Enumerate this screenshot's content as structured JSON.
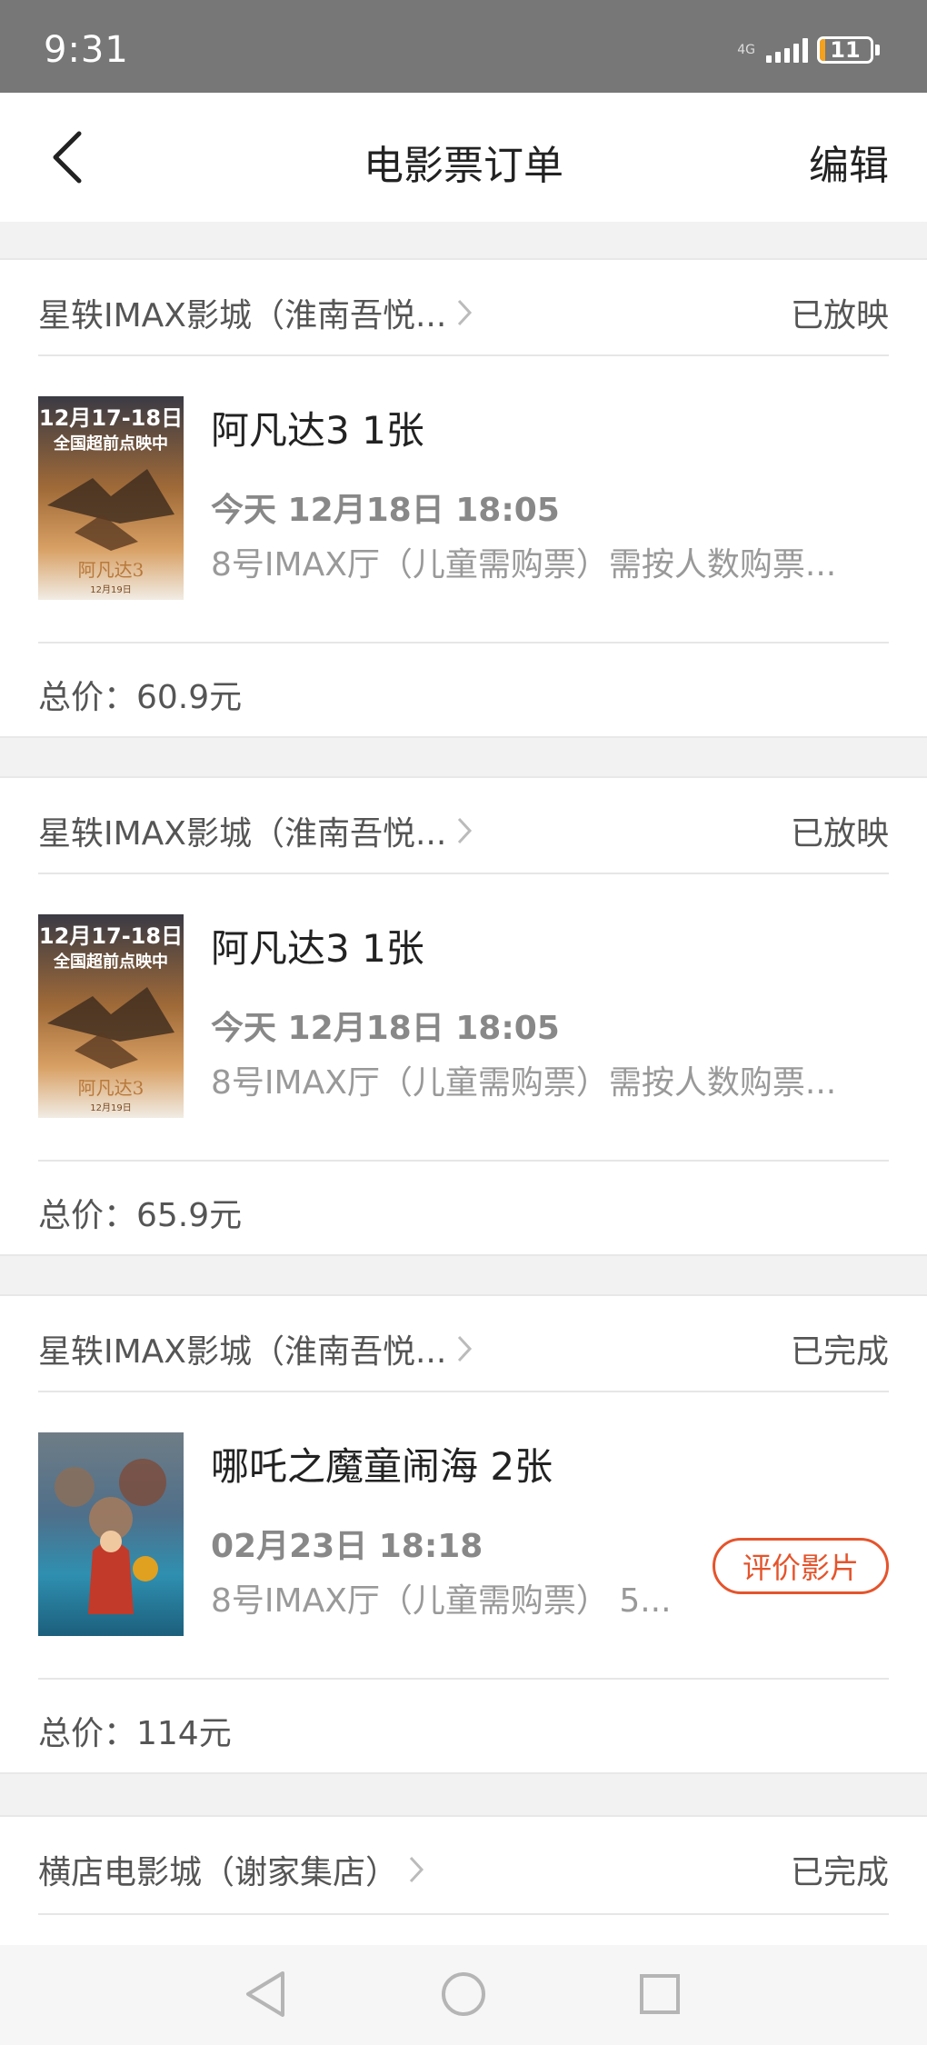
{
  "status_bar": {
    "time": "9:31",
    "network_small": "4G",
    "battery": "11",
    "battery_level": 0.11
  },
  "nav": {
    "title": "电影票订单",
    "edit_label": "编辑"
  },
  "orders": [
    {
      "cinema": "星轶IMAX影城（淮南吾悦...",
      "status": "已放映",
      "movie_title": "阿凡达3 1张",
      "show_time": "今天 12月18日 18:05",
      "hall": "8号IMAX厅（儿童需购票）需按人数购票...",
      "total": "总价：60.9元",
      "poster": {
        "line1": "12月17-18日",
        "line2": "全国超前点映中",
        "name": "阿凡达3",
        "date": "12月19日"
      }
    },
    {
      "cinema": "星轶IMAX影城（淮南吾悦...",
      "status": "已放映",
      "movie_title": "阿凡达3 1张",
      "show_time": "今天 12月18日 18:05",
      "hall": "8号IMAX厅（儿童需购票）需按人数购票...",
      "total": "总价：65.9元",
      "poster": {
        "line1": "12月17-18日",
        "line2": "全国超前点映中",
        "name": "阿凡达3",
        "date": "12月19日"
      }
    },
    {
      "cinema": "星轶IMAX影城（淮南吾悦...",
      "status": "已完成",
      "movie_title": "哪吒之魔童闹海 2张",
      "show_time": "02月23日 18:18",
      "hall": "8号IMAX厅（儿童需购票） 5...",
      "review_label": "评价影片",
      "total": "总价：114元"
    },
    {
      "cinema": "横店电影城（谢家集店）",
      "status": "已完成"
    }
  ],
  "colors": {
    "accent": "#e5542c",
    "status_bar": "#777777",
    "background": "#f2f2f2"
  },
  "icons": {
    "back": "chevron-left-icon",
    "chevron": "chevron-right-icon",
    "nav_back": "triangle-back-icon",
    "nav_home": "circle-home-icon",
    "nav_recent": "square-recent-icon"
  }
}
